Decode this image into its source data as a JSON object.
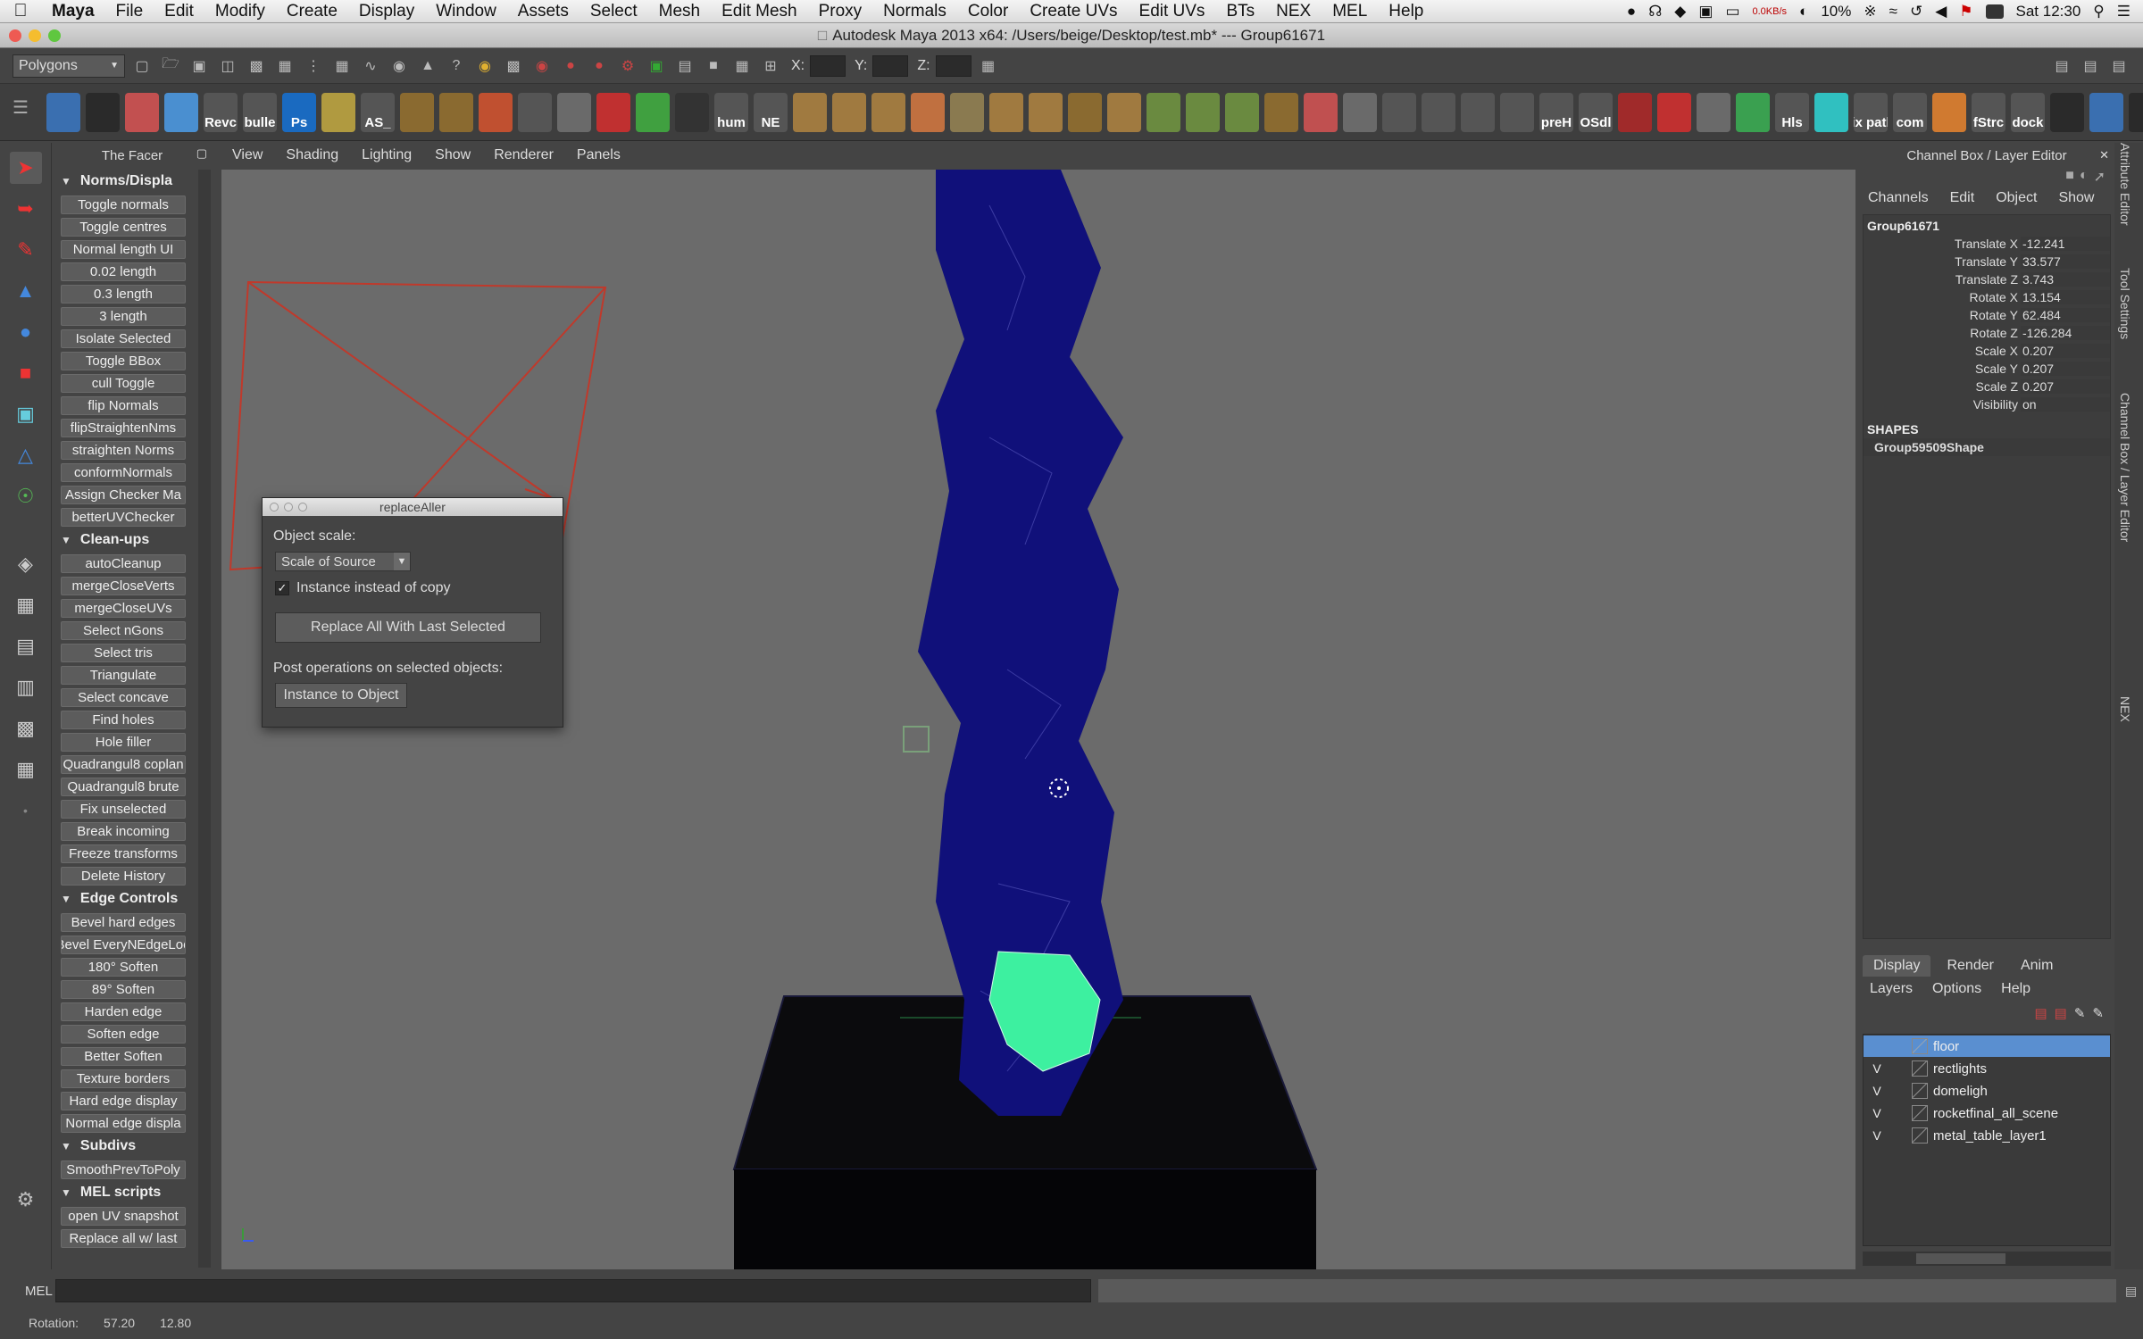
{
  "mac_menubar": {
    "app": "Maya",
    "items": [
      "File",
      "Edit",
      "Modify",
      "Create",
      "Display",
      "Window",
      "Assets",
      "Select",
      "Mesh",
      "Edit Mesh",
      "Proxy",
      "Normals",
      "Color",
      "Create UVs",
      "Edit UVs",
      "BTs",
      "NEX",
      "MEL",
      "Help"
    ],
    "status": {
      "net": "0.0KB/s",
      "battery": "10%",
      "clock": "Sat 12:30"
    }
  },
  "window": {
    "title": "Autodesk Maya 2013 x64: /Users/beige/Desktop/test.mb*   ---   Group61671"
  },
  "statusline": {
    "mode": "Polygons",
    "x_label": "X:",
    "y_label": "Y:",
    "z_label": "Z:"
  },
  "shelf": {
    "labels": [
      "",
      "",
      "",
      "",
      "Revc",
      "bulle",
      "Ps",
      "",
      "AS_",
      "",
      "",
      "",
      "",
      "",
      "",
      "",
      "",
      "hum",
      "NE",
      "",
      "",
      "",
      "",
      "",
      "",
      "",
      "",
      "",
      "",
      "",
      "",
      "",
      "",
      "",
      "",
      "",
      "",
      "",
      "preH",
      "OSdl",
      "",
      "",
      "",
      "",
      "Hls",
      "",
      "fix path",
      "com",
      "",
      "fStrc",
      "dock",
      "",
      "",
      ""
    ]
  },
  "facer": {
    "title": "The Facer",
    "sections": [
      {
        "name": "Norms/Displa",
        "buttons": [
          "Toggle normals",
          "Toggle centres",
          "Normal length UI",
          "0.02 length",
          "0.3 length",
          "3 length",
          "Isolate Selected",
          "Toggle BBox",
          "cull Toggle",
          "flip Normals",
          "flipStraightenNms",
          "straighten Norms",
          "conformNormals",
          "Assign Checker Ma",
          "betterUVChecker"
        ]
      },
      {
        "name": "Clean-ups",
        "buttons": [
          "autoCleanup",
          "mergeCloseVerts",
          "mergeCloseUVs",
          "Select nGons",
          "Select tris",
          "Triangulate",
          "Select concave",
          "Find holes",
          "Hole filler",
          "Quadrangul8 coplan",
          "Quadrangul8 brute",
          "Fix unselected",
          "Break incoming",
          "Freeze transforms",
          "Delete History"
        ]
      },
      {
        "name": "Edge Controls",
        "buttons": [
          "Bevel hard edges",
          "Bevel EveryNEdgeLoo",
          "180° Soften",
          "89° Soften",
          "Harden edge",
          "Soften edge",
          "Better Soften",
          "Texture borders",
          "Hard edge display",
          "Normal edge displa"
        ]
      },
      {
        "name": "Subdivs",
        "buttons": [
          "SmoothPrevToPoly"
        ]
      },
      {
        "name": "MEL scripts",
        "buttons": [
          "open UV snapshot",
          "Replace all w/ last"
        ]
      }
    ]
  },
  "viewport": {
    "menu": [
      "View",
      "Shading",
      "Lighting",
      "Show",
      "Renderer",
      "Panels"
    ],
    "colors": {
      "background": "#6b6b6b",
      "mesh": "#10107a",
      "selected": "#3df0a0",
      "camera": "#c0392b"
    }
  },
  "replace_window": {
    "title": "replaceAller",
    "object_scale_label": "Object scale:",
    "scale_option": "Scale of Source",
    "instance_checkbox": "Instance instead of copy",
    "instance_checked": true,
    "replace_button": "Replace All With Last Selected",
    "post_label": "Post operations on selected objects:",
    "instance_button": "Instance to Object"
  },
  "channel_box": {
    "title": "Channel Box / Layer Editor",
    "menu": [
      "Channels",
      "Edit",
      "Object",
      "Show"
    ],
    "object": "Group61671",
    "channels": [
      {
        "name": "Translate X",
        "value": "-12.241"
      },
      {
        "name": "Translate Y",
        "value": "33.577"
      },
      {
        "name": "Translate Z",
        "value": "3.743"
      },
      {
        "name": "Rotate X",
        "value": "13.154"
      },
      {
        "name": "Rotate Y",
        "value": "62.484"
      },
      {
        "name": "Rotate Z",
        "value": "-126.284"
      },
      {
        "name": "Scale X",
        "value": "0.207"
      },
      {
        "name": "Scale Y",
        "value": "0.207"
      },
      {
        "name": "Scale Z",
        "value": "0.207"
      },
      {
        "name": "Visibility",
        "value": "on"
      }
    ],
    "shapes_label": "SHAPES",
    "shape": "Group59509Shape"
  },
  "side_tabs": [
    "Attribute Editor",
    "Tool Settings",
    "Channel Box / Layer Editor",
    "NEX"
  ],
  "layer_editor": {
    "tabs": [
      "Display",
      "Render",
      "Anim"
    ],
    "menu": [
      "Layers",
      "Options",
      "Help"
    ],
    "layers": [
      {
        "v": "",
        "name": "floor",
        "selected": true
      },
      {
        "v": "V",
        "name": "rectlights",
        "selected": false
      },
      {
        "v": "V",
        "name": "domeligh",
        "selected": false
      },
      {
        "v": "V",
        "name": "rocketfinal_all_scene",
        "selected": false
      },
      {
        "v": "V",
        "name": "metal_table_layer1",
        "selected": false
      }
    ]
  },
  "command_line": {
    "label": "MEL"
  },
  "help_line": {
    "label": "Rotation:",
    "v1": "57.20",
    "v2": "12.80"
  }
}
